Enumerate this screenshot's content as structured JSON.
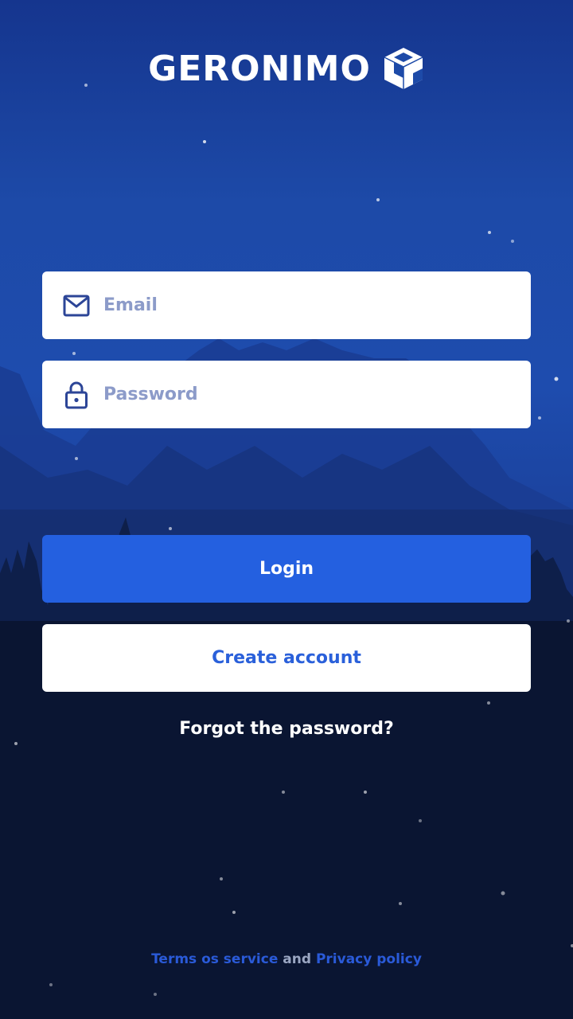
{
  "app": {
    "name": "GERONIMO",
    "logo_icon": "cube-icon"
  },
  "form": {
    "email": {
      "placeholder": "Email",
      "value": "",
      "icon": "envelope-icon"
    },
    "password": {
      "placeholder": "Password",
      "value": "",
      "icon": "lock-icon"
    }
  },
  "actions": {
    "login_label": "Login",
    "create_account_label": "Create account",
    "forgot_label": "Forgot the password?"
  },
  "footer": {
    "terms_label": "Terms os service",
    "and_label": "and",
    "privacy_label": "Privacy policy"
  },
  "colors": {
    "primary": "#2460e0",
    "link": "#2a5ad8",
    "input_icon": "#2c4597",
    "placeholder": "#8c9bc9"
  }
}
